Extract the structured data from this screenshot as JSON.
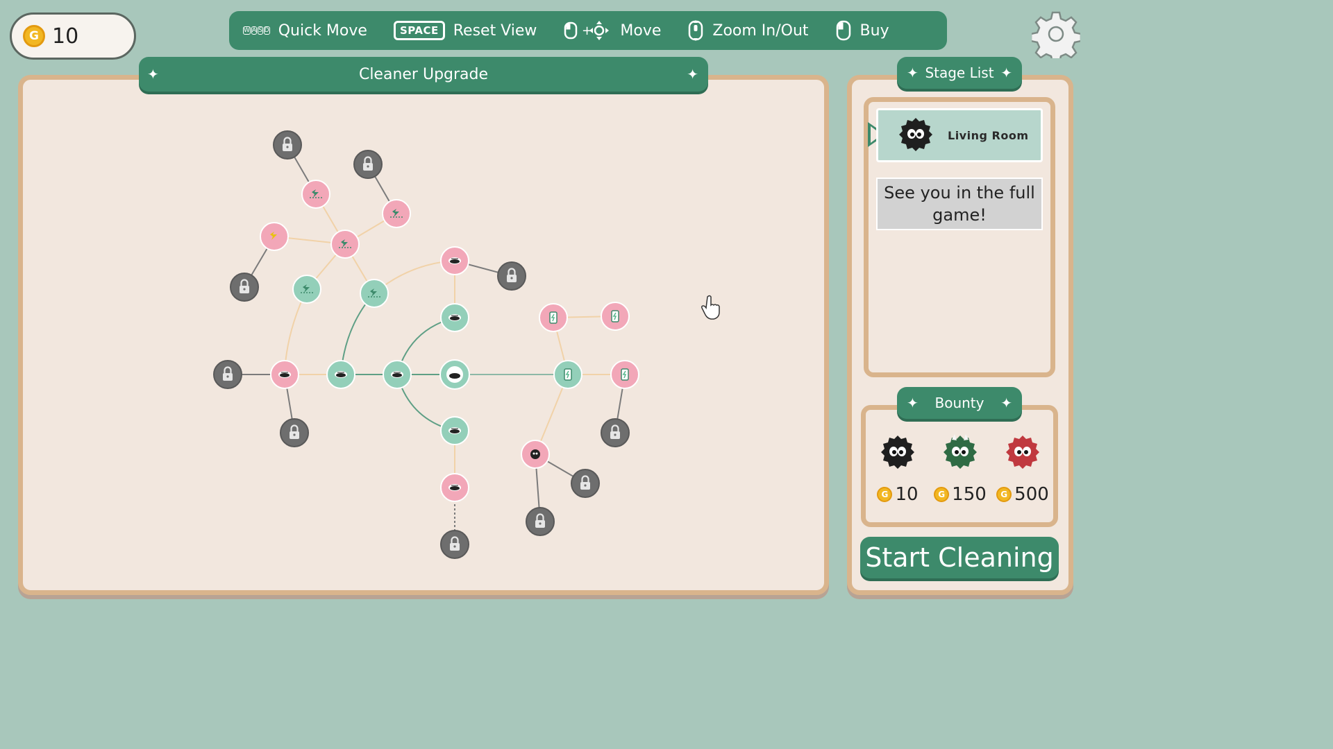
{
  "coins": {
    "amount": "10",
    "symbol": "G"
  },
  "controls": [
    {
      "label": "Quick Move",
      "icon": "wasd-keys-icon",
      "keys": [
        "W",
        "A",
        "S",
        "D"
      ]
    },
    {
      "label": "Reset View",
      "icon": "space-key-icon",
      "key": "SPACE"
    },
    {
      "label": "Move",
      "icon": "mouse-drag-icon"
    },
    {
      "label": "Zoom In/Out",
      "icon": "mouse-wheel-icon"
    },
    {
      "label": "Buy",
      "icon": "mouse-left-click-icon"
    }
  ],
  "upgrade_panel": {
    "title": "Cleaner Upgrade"
  },
  "stage_panel": {
    "title": "Stage List",
    "stages": [
      {
        "name": "Living Room",
        "selected": true
      }
    ],
    "notice": "See you in the full game!"
  },
  "bounty": {
    "title": "Bounty",
    "items": [
      {
        "monster": "black-dust-bunny",
        "reward": "10"
      },
      {
        "monster": "green-horned-dust-bunny",
        "reward": "150"
      },
      {
        "monster": "red-dust-bunny",
        "reward": "500"
      }
    ]
  },
  "start_button": "Start Cleaning",
  "colors": {
    "background": "#a8c7bb",
    "accent_green": "#3d8a6b",
    "panel_fill": "#f2e7de",
    "panel_border": "#d9b48c",
    "node_pink": "#f2a7b8",
    "node_teal": "#93cfb9",
    "node_locked": "#6e6e6e",
    "coin_gold": "#f2b722"
  }
}
